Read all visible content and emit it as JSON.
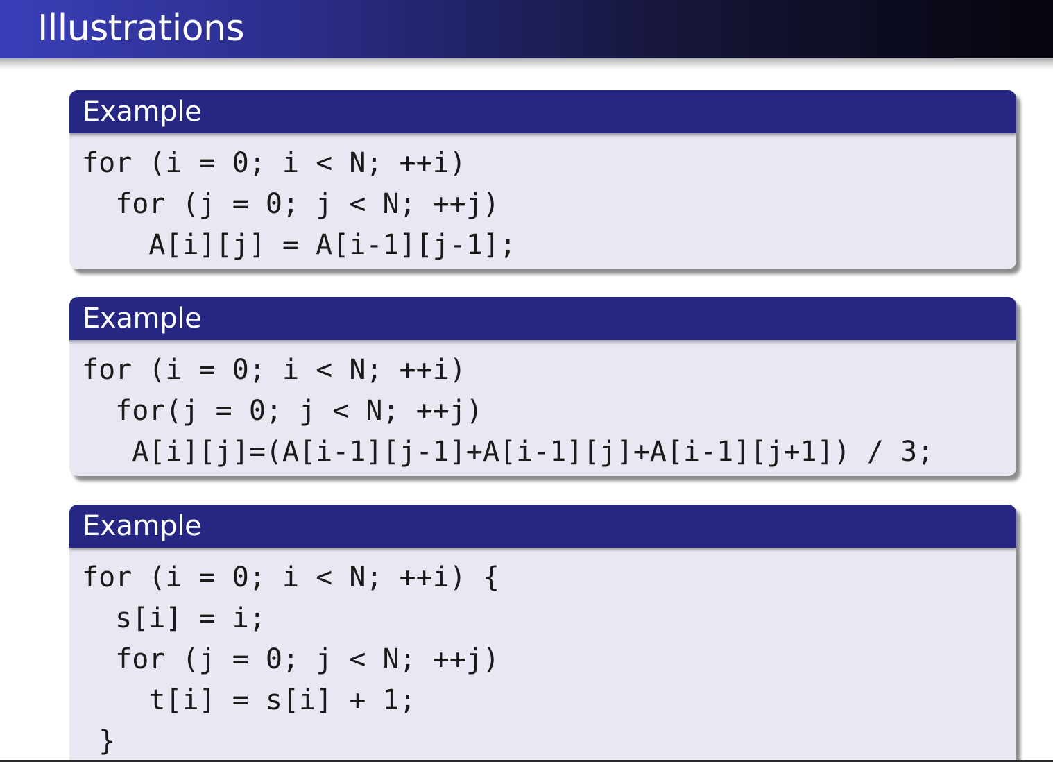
{
  "slide": {
    "title": "Illustrations"
  },
  "examples": [
    {
      "title": "Example",
      "lines": [
        "for (i = 0; i < N; ++i)",
        "  for (j = 0; j < N; ++j)",
        "    A[i][j] = A[i-1][j-1];"
      ]
    },
    {
      "title": "Example",
      "lines": [
        "for (i = 0; i < N; ++i)",
        "  for(j = 0; j < N; ++j)",
        "   A[i][j]=(A[i-1][j-1]+A[i-1][j]+A[i-1][j+1]) / 3;"
      ]
    },
    {
      "title": "Example",
      "lines": [
        "for (i = 0; i < N; ++i) {",
        "  s[i] = i;",
        "  for (j = 0; j < N; ++j)",
        "    t[i] = s[i] + 1;",
        " }"
      ]
    }
  ],
  "colors": {
    "title_bar_start": "#3a3fb8",
    "title_bar_end": "#05050d",
    "block_header": "#262783",
    "block_body": "#e8e8f2"
  }
}
